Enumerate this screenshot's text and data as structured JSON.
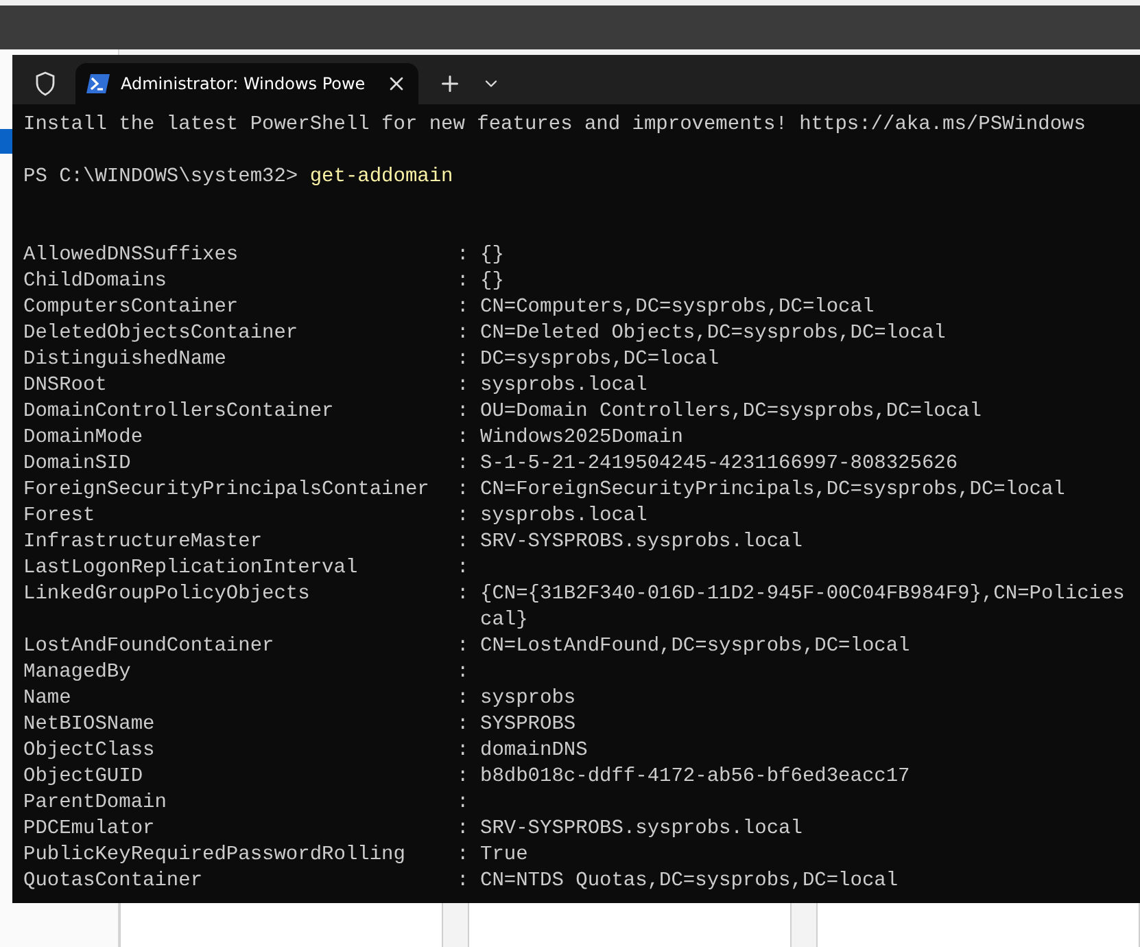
{
  "terminal": {
    "tab": {
      "title": "Administrator: Windows Powe",
      "selected": true
    },
    "banner": "Install the latest PowerShell for new features and improvements! https://aka.ms/PSWindows",
    "prompt": {
      "path": "PS C:\\WINDOWS\\system32>",
      "command": "get-addomain"
    },
    "properties": [
      {
        "name": "AllowedDNSSuffixes",
        "separator": ":",
        "value": "{}"
      },
      {
        "name": "ChildDomains",
        "separator": ":",
        "value": "{}"
      },
      {
        "name": "ComputersContainer",
        "separator": ":",
        "value": "CN=Computers,DC=sysprobs,DC=local"
      },
      {
        "name": "DeletedObjectsContainer",
        "separator": ":",
        "value": "CN=Deleted Objects,DC=sysprobs,DC=local"
      },
      {
        "name": "DistinguishedName",
        "separator": ":",
        "value": "DC=sysprobs,DC=local"
      },
      {
        "name": "DNSRoot",
        "separator": ":",
        "value": "sysprobs.local"
      },
      {
        "name": "DomainControllersContainer",
        "separator": ":",
        "value": "OU=Domain Controllers,DC=sysprobs,DC=local"
      },
      {
        "name": "DomainMode",
        "separator": ":",
        "value": "Windows2025Domain"
      },
      {
        "name": "DomainSID",
        "separator": ":",
        "value": "S-1-5-21-2419504245-4231166997-808325626"
      },
      {
        "name": "ForeignSecurityPrincipalsContainer",
        "separator": ":",
        "value": "CN=ForeignSecurityPrincipals,DC=sysprobs,DC=local"
      },
      {
        "name": "Forest",
        "separator": ":",
        "value": "sysprobs.local"
      },
      {
        "name": "InfrastructureMaster",
        "separator": ":",
        "value": "SRV-SYSPROBS.sysprobs.local"
      },
      {
        "name": "LastLogonReplicationInterval",
        "separator": ":"
      },
      {
        "name": "LinkedGroupPolicyObjects",
        "separator": ":",
        "value": "{CN={31B2F340-016D-11D2-945F-00C04FB984F9},CN=Policies",
        "continuation": "cal}"
      },
      {
        "name": "LostAndFoundContainer",
        "separator": ":",
        "value": "CN=LostAndFound,DC=sysprobs,DC=local"
      },
      {
        "name": "ManagedBy",
        "separator": ":"
      },
      {
        "name": "Name",
        "separator": ":",
        "value": "sysprobs"
      },
      {
        "name": "NetBIOSName",
        "separator": ":",
        "value": "SYSPROBS"
      },
      {
        "name": "ObjectClass",
        "separator": ":",
        "value": "domainDNS"
      },
      {
        "name": "ObjectGUID",
        "separator": ":",
        "value": "b8db018c-ddff-4172-ab56-bf6ed3eacc17"
      },
      {
        "name": "ParentDomain",
        "separator": ":"
      },
      {
        "name": "PDCEmulator",
        "separator": ":",
        "value": "SRV-SYSPROBS.sysprobs.local"
      },
      {
        "name": "PublicKeyRequiredPasswordRolling",
        "separator": ":",
        "value": "True"
      },
      {
        "name": "QuotasContainer",
        "separator": ":",
        "value": "CN=NTDS Quotas,DC=sysprobs,DC=local"
      }
    ]
  }
}
